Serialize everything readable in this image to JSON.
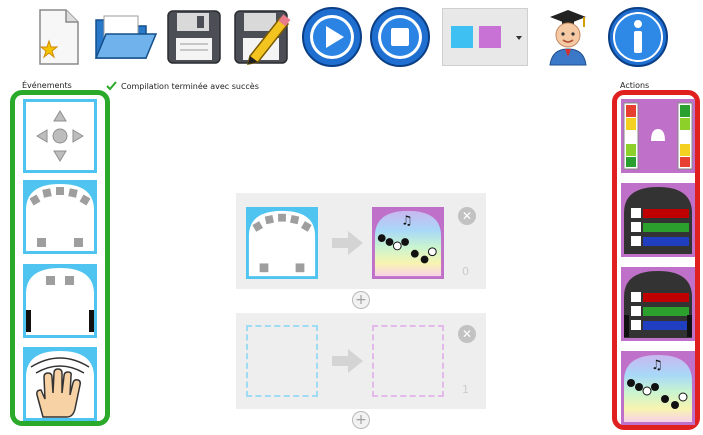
{
  "toolbar": {
    "buttons": [
      {
        "icon": "new-file-icon"
      },
      {
        "icon": "open-folder-icon"
      },
      {
        "icon": "save-icon"
      },
      {
        "icon": "save-as-icon"
      },
      {
        "icon": "run-icon"
      },
      {
        "icon": "stop-icon"
      },
      {
        "icon": "color-scheme-icon"
      },
      {
        "icon": "advanced-mode-icon"
      },
      {
        "icon": "info-icon"
      }
    ]
  },
  "left_panel": {
    "title": "Événements",
    "items": [
      {
        "icon": "buttons-event-icon"
      },
      {
        "icon": "proximity-event-icon"
      },
      {
        "icon": "ground-event-icon"
      },
      {
        "icon": "tap-event-icon"
      }
    ]
  },
  "status": {
    "text": "Compilation terminée avec succès",
    "icon": "check-icon"
  },
  "right_panel": {
    "title": "Actions",
    "items": [
      {
        "icon": "motors-action-icon"
      },
      {
        "icon": "top-color-action-icon"
      },
      {
        "icon": "bottom-color-action-icon"
      },
      {
        "icon": "music-action-icon"
      }
    ]
  },
  "rules": [
    {
      "number": "0",
      "event_icon": "proximity-event-icon",
      "action_icon": "music-action-icon"
    },
    {
      "number": "1",
      "event_icon": "empty-event-slot",
      "action_icon": "empty-action-slot"
    }
  ],
  "colors": {
    "event_blue": "#50c4f0",
    "action_purple": "#bf70c8",
    "events_border": "#2aa92a",
    "actions_border": "#e01f1f",
    "rule_background": "#eeeeee"
  }
}
